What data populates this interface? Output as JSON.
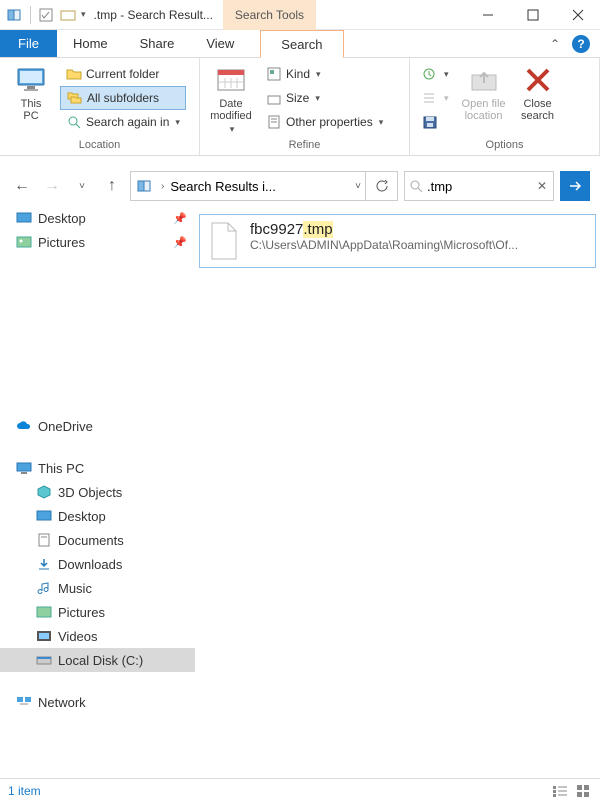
{
  "title": ".tmp - Search Result...",
  "context_tab": "Search Tools",
  "tabs": {
    "file": "File",
    "home": "Home",
    "share": "Share",
    "view": "View",
    "search": "Search"
  },
  "ribbon": {
    "location": {
      "this_pc": "This\nPC",
      "current_folder": "Current folder",
      "all_subfolders": "All subfolders",
      "search_again": "Search again in",
      "label": "Location"
    },
    "refine": {
      "date_modified": "Date\nmodified",
      "kind": "Kind",
      "size": "Size",
      "other": "Other properties",
      "label": "Refine"
    },
    "options": {
      "recent": "",
      "advanced": "",
      "save": "",
      "open_file": "Open file\nlocation",
      "close": "Close\nsearch",
      "label": "Options"
    }
  },
  "address": {
    "text": "Search Results i...",
    "dropdown": "▾"
  },
  "search": {
    "query": ".tmp"
  },
  "nav": {
    "quick": [
      {
        "icon": "desktop",
        "label": "Desktop",
        "pinned": true
      },
      {
        "icon": "pictures",
        "label": "Pictures",
        "pinned": true
      }
    ],
    "onedrive": "OneDrive",
    "thispc": "This PC",
    "thispc_children": [
      {
        "icon": "3d",
        "label": "3D Objects"
      },
      {
        "icon": "desktop",
        "label": "Desktop"
      },
      {
        "icon": "docs",
        "label": "Documents"
      },
      {
        "icon": "downloads",
        "label": "Downloads"
      },
      {
        "icon": "music",
        "label": "Music"
      },
      {
        "icon": "pictures",
        "label": "Pictures"
      },
      {
        "icon": "videos",
        "label": "Videos"
      },
      {
        "icon": "disk",
        "label": "Local Disk (C:)"
      }
    ],
    "network": "Network"
  },
  "result": {
    "name_prefix": "fbc9927",
    "name_hl": ".tmp",
    "path": "C:\\Users\\ADMIN\\AppData\\Roaming\\Microsoft\\Of..."
  },
  "status": {
    "count": "1 item"
  }
}
